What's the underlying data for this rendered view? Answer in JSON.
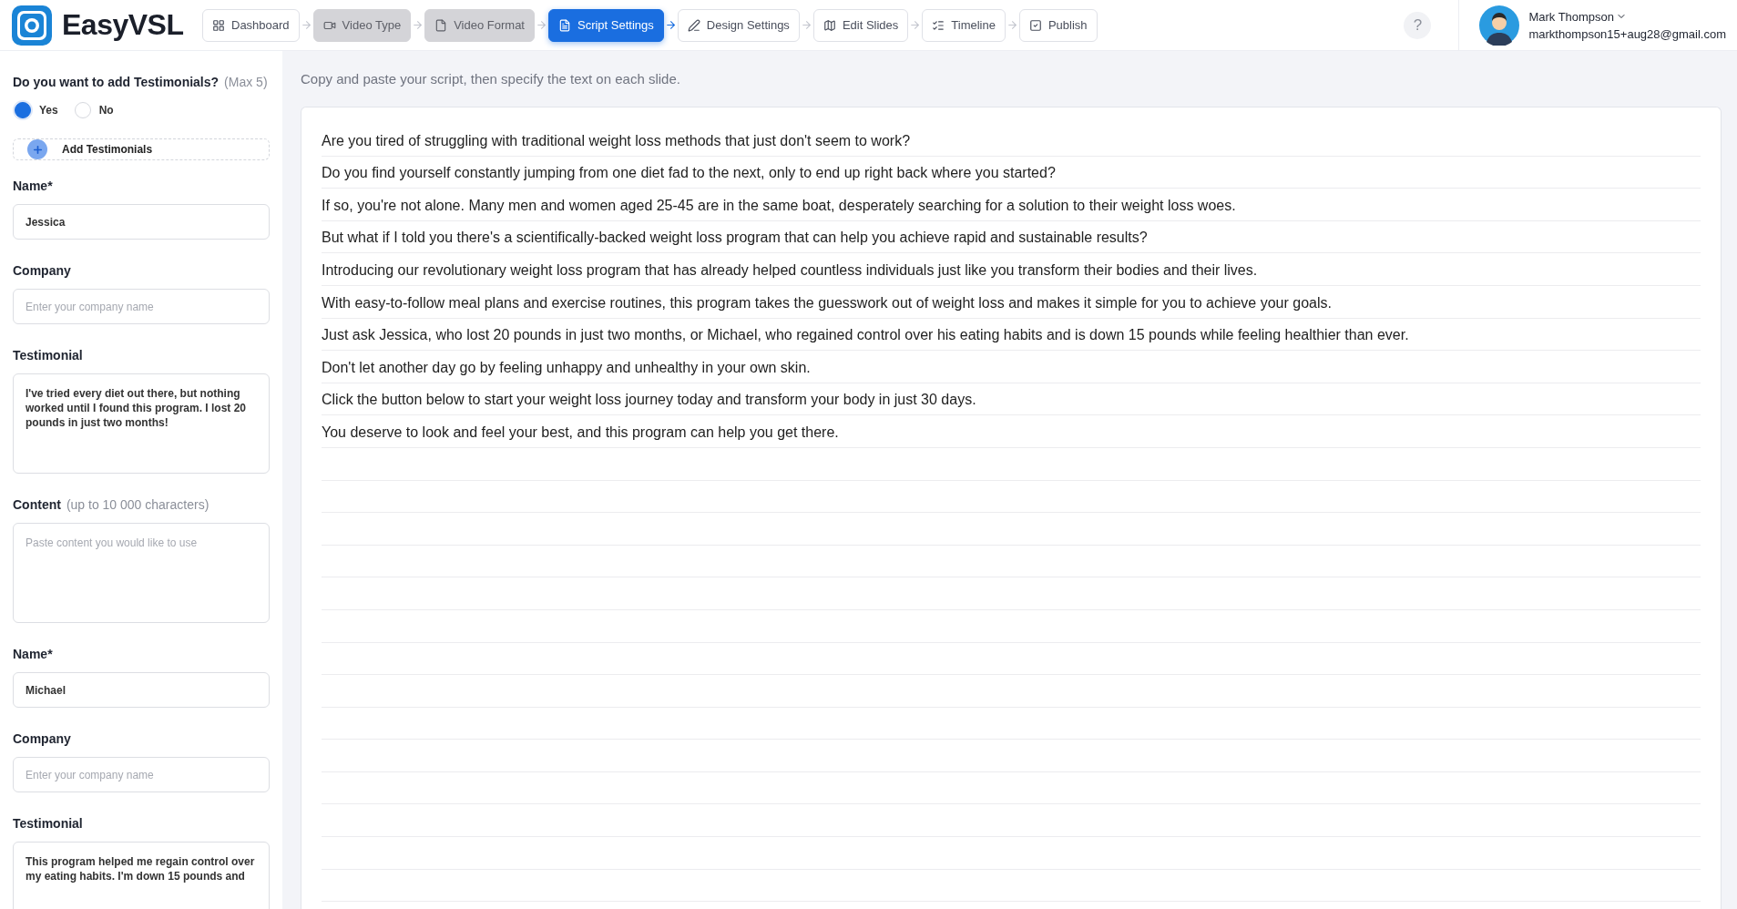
{
  "header": {
    "logo_text": "EasyVSL",
    "steps": [
      {
        "label": "Dashboard",
        "selected": false,
        "disabled": false
      },
      {
        "label": "Video Type",
        "selected": false,
        "disabled": true
      },
      {
        "label": "Video Format",
        "selected": false,
        "disabled": true
      },
      {
        "label": "Script Settings",
        "selected": true,
        "disabled": false
      },
      {
        "label": "Design Settings",
        "selected": false,
        "disabled": false
      },
      {
        "label": "Edit Slides",
        "selected": false,
        "disabled": false
      },
      {
        "label": "Timeline",
        "selected": false,
        "disabled": false
      },
      {
        "label": "Publish",
        "selected": false,
        "disabled": false
      }
    ],
    "help": "?",
    "user": {
      "name": "Mark Thompson",
      "email": "markthompson15+aug28@gmail.com"
    }
  },
  "sidebar": {
    "question": {
      "label": "Do you want to add Testimonials?",
      "hint": "(Max 5)",
      "options": [
        {
          "label": "Yes",
          "selected": true
        },
        {
          "label": "No",
          "selected": false
        }
      ]
    },
    "add_button": "Add Testimonials",
    "fields": [
      {
        "kind": "input",
        "label": "Name*",
        "value": "Jessica"
      },
      {
        "kind": "input",
        "label": "Company",
        "placeholder": "Enter your company name"
      },
      {
        "kind": "textarea",
        "label": "Testimonial",
        "value": "I've tried every diet out there, but nothing worked until I found this program. I lost 20 pounds in just two months!"
      },
      {
        "kind": "textarea",
        "label": "Content",
        "hint": "(up to 10 000 characters)",
        "placeholder": "Paste content you would like to use"
      },
      {
        "kind": "input",
        "label": "Name*",
        "value": "Michael"
      },
      {
        "kind": "input",
        "label": "Company",
        "placeholder": "Enter your company name"
      },
      {
        "kind": "textarea",
        "label": "Testimonial",
        "value": "This program helped me regain control over my eating habits. I'm down 15 pounds and"
      }
    ]
  },
  "script": {
    "instruction": "Copy and paste your script, then specify the text on each slide.",
    "lines": [
      "Are you tired of struggling with traditional weight loss methods that just don't seem to work?",
      "Do you find yourself constantly jumping from one diet fad to the next, only to end up right back where you started?",
      "If so, you're not alone. Many men and women aged 25-45 are in the same boat, desperately searching for a solution to their weight loss woes.",
      "But what if I told you there's a scientifically-backed weight loss program that can help you achieve rapid and sustainable results?",
      "Introducing our revolutionary weight loss program that has already helped countless individuals just like you transform their bodies and their lives.",
      "With easy-to-follow meal plans and exercise routines, this program takes the guesswork out of weight loss and makes it simple for you to achieve your goals.",
      "Just ask Jessica, who lost 20 pounds in just two months, or Michael, who regained control over his eating habits and is down 15 pounds while feeling healthier than ever.",
      "Don't let another day go by feeling unhappy and unhealthy in your own skin.",
      "Click the button below to start your weight loss journey today and transform your body in just 30 days.",
      "You deserve to look and feel your best, and this program can help you get there."
    ]
  }
}
